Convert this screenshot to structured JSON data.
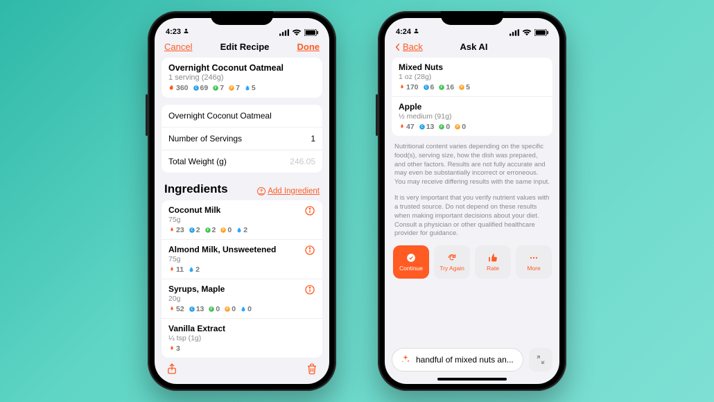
{
  "accent": "#ff5b22",
  "phone1": {
    "status": {
      "time": "4:23",
      "user_icon": "person"
    },
    "nav": {
      "cancel": "Cancel",
      "title": "Edit Recipe",
      "done": "Done"
    },
    "summary": {
      "name": "Overnight Coconut Oatmeal",
      "serving_text": "1 serving (246g)",
      "nutrients": {
        "cal": "360",
        "carb": "69",
        "fat": "7",
        "protein": "7",
        "water": "5"
      }
    },
    "fields": {
      "name_value": "Overnight Coconut Oatmeal",
      "servings_label": "Number of Servings",
      "servings_value": "1",
      "weight_label": "Total Weight (g)",
      "weight_value": "246.05"
    },
    "ingredients_header": "Ingredients",
    "add_ingredient_label": "Add Ingredient",
    "ingredients": [
      {
        "name": "Coconut Milk",
        "amount": "75g",
        "n": {
          "cal": "23",
          "carb": "2",
          "fat": "2",
          "protein": "0",
          "water": "2"
        }
      },
      {
        "name": "Almond Milk, Unsweetened",
        "amount": "75g",
        "n": {
          "cal": "11",
          "water": "2"
        }
      },
      {
        "name": "Syrups, Maple",
        "amount": "20g",
        "n": {
          "cal": "52",
          "carb": "13",
          "fat": "0",
          "protein": "0",
          "water": "0"
        }
      },
      {
        "name": "Vanilla Extract",
        "amount": "¼ tsp (1g)",
        "n": {
          "cal": "3"
        }
      }
    ]
  },
  "phone2": {
    "status": {
      "time": "4:24"
    },
    "nav": {
      "back": "Back",
      "title": "Ask AI"
    },
    "foods": [
      {
        "name": "Mixed Nuts",
        "amount": "1 oz (28g)",
        "n": {
          "cal": "170",
          "carb": "6",
          "fat": "16",
          "protein": "5"
        }
      },
      {
        "name": "Apple",
        "amount": "½ medium (91g)",
        "n": {
          "cal": "47",
          "carb": "13",
          "fat": "0",
          "protein": "0"
        }
      }
    ],
    "disclaimer1": "Nutritional content varies depending on the specific food(s), serving size, how the dish was prepared, and other factors. Results are not fully accurate and may even be substantially incorrect or erroneous. You may receive differing results with the same input.",
    "disclaimer2": "It is very important that you verify nutrient values with a trusted source. Do not depend on these results when making important decisions about your diet. Consult a physician or other qualified healthcare provider for guidance.",
    "buttons": {
      "continue": "Continue",
      "try_again": "Try Again",
      "rate": "Rate",
      "more": "More"
    },
    "search_value": "handful of mixed nuts an..."
  }
}
